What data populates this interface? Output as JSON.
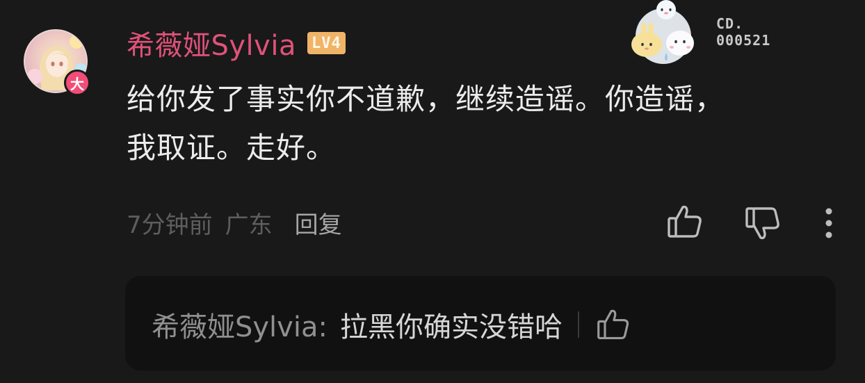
{
  "comment": {
    "username": "希薇娅Sylvia",
    "level": "LV4",
    "avatar_badge": "大",
    "decoration_code_line1": "CD.",
    "decoration_code_line2": "000521",
    "text_line1": "给你发了事实你不道歉，继续造谣。你造谣，",
    "text_line2": "我取证。走好。",
    "time": "7分钟前",
    "location": "广东",
    "reply_label": "回复"
  },
  "reply": {
    "author": "希薇娅Sylvia:",
    "content": "拉黑你确实没错哈"
  },
  "colors": {
    "background": "#191919",
    "username": "#e0527a",
    "level_badge": "#f0b468",
    "avatar_badge": "#f24d78",
    "reply_box": "#111111"
  },
  "icons": {
    "like": "thumbs-up-icon",
    "dislike": "thumbs-down-icon",
    "more": "vertical-ellipsis-icon"
  }
}
